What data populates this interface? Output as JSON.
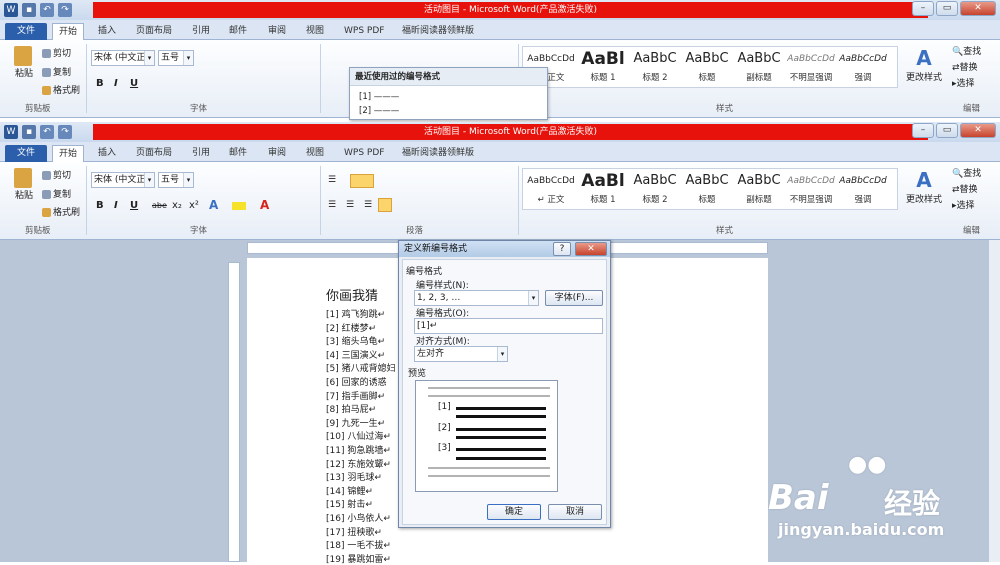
{
  "window": {
    "title": "活动图目 - Microsoft Word(产品激活失败)",
    "qat_icons": [
      "word-logo-icon",
      "save-icon",
      "undo-icon",
      "redo-icon"
    ]
  },
  "tabs": [
    "文件",
    "开始",
    "插入",
    "页面布局",
    "引用",
    "邮件",
    "审阅",
    "视图",
    "WPS PDF",
    "福昕阅读器领鲜版"
  ],
  "clipboard": {
    "paste": "粘贴",
    "cut": "剪切",
    "copy": "复制",
    "format_painter": "格式刷",
    "group": "剪贴板"
  },
  "font": {
    "name": "宋体 (中文正)",
    "size": "五号",
    "group": "字体",
    "bold": "B",
    "italic": "I",
    "underline": "U",
    "strike": "abe",
    "sub": "x₂",
    "sup": "x²",
    "aa": "Aa"
  },
  "paragraph": {
    "group": "段落"
  },
  "styles": {
    "group": "样式",
    "items": [
      {
        "sample": "AaBbCcDd",
        "name": "↵ 正文"
      },
      {
        "sample": "AaBl",
        "name": "标题 1"
      },
      {
        "sample": "AaBbC",
        "name": "标题 2"
      },
      {
        "sample": "AaBbC",
        "name": "标题"
      },
      {
        "sample": "AaBbC",
        "name": "副标题"
      },
      {
        "sample": "AaBbCcDd",
        "name": "不明显强调"
      },
      {
        "sample": "AaBbCcDd",
        "name": "强调"
      }
    ],
    "change_styles": "更改样式"
  },
  "editing": {
    "find": "查找",
    "replace": "替换",
    "select": "选择",
    "group": "编辑"
  },
  "recent_dropdown": {
    "title": "最近使用过的编号格式",
    "items": [
      "[1] ———",
      "[2] ———"
    ]
  },
  "ruler_numbers": [
    "8",
    "6",
    "4",
    "2",
    "2",
    "4",
    "6",
    "8",
    "10",
    "32",
    "34",
    "36",
    "38",
    "40",
    "42",
    "44",
    "46",
    "48"
  ],
  "document": {
    "heading": "你画我猜",
    "items": [
      "[1]  鸡飞狗跳↵",
      "[2]  红楼梦↵",
      "[3]  缩头乌龟↵",
      "[4]  三国演义↵",
      "[5]  猪八戒背媳妇",
      "[6]  回家的诱惑",
      "[7]  指手画脚↵",
      "[8]  拍马屁↵",
      "[9]  九死一生↵",
      "[10]  八仙过海↵",
      "[11]  狗急跳墙↵",
      "[12]  东施效颦↵",
      "[13]  羽毛球↵",
      "[14]  锦鲤↵",
      "[15]  射击↵",
      "[16]  小鸟依人↵",
      "[17]  扭秧歌↵",
      "[18]  一毛不拔↵",
      "[19]  暴跳如雷↵"
    ]
  },
  "dialog": {
    "title": "定义新编号格式",
    "section": "编号格式",
    "style_label": "编号样式(N):",
    "style_value": "1, 2, 3, …",
    "font_button": "字体(F)...",
    "format_label": "编号格式(O):",
    "format_value": "[1]↵",
    "align_label": "对齐方式(M):",
    "align_value": "左对齐",
    "preview_label": "预览",
    "preview_items": [
      "[1]",
      "[2]",
      "[3]"
    ],
    "ok": "确定",
    "cancel": "取消",
    "help": "?",
    "close": "✕"
  },
  "watermark": {
    "brand": "Bai",
    "brand2": "经验",
    "url": "jingyan.baidu.com"
  }
}
